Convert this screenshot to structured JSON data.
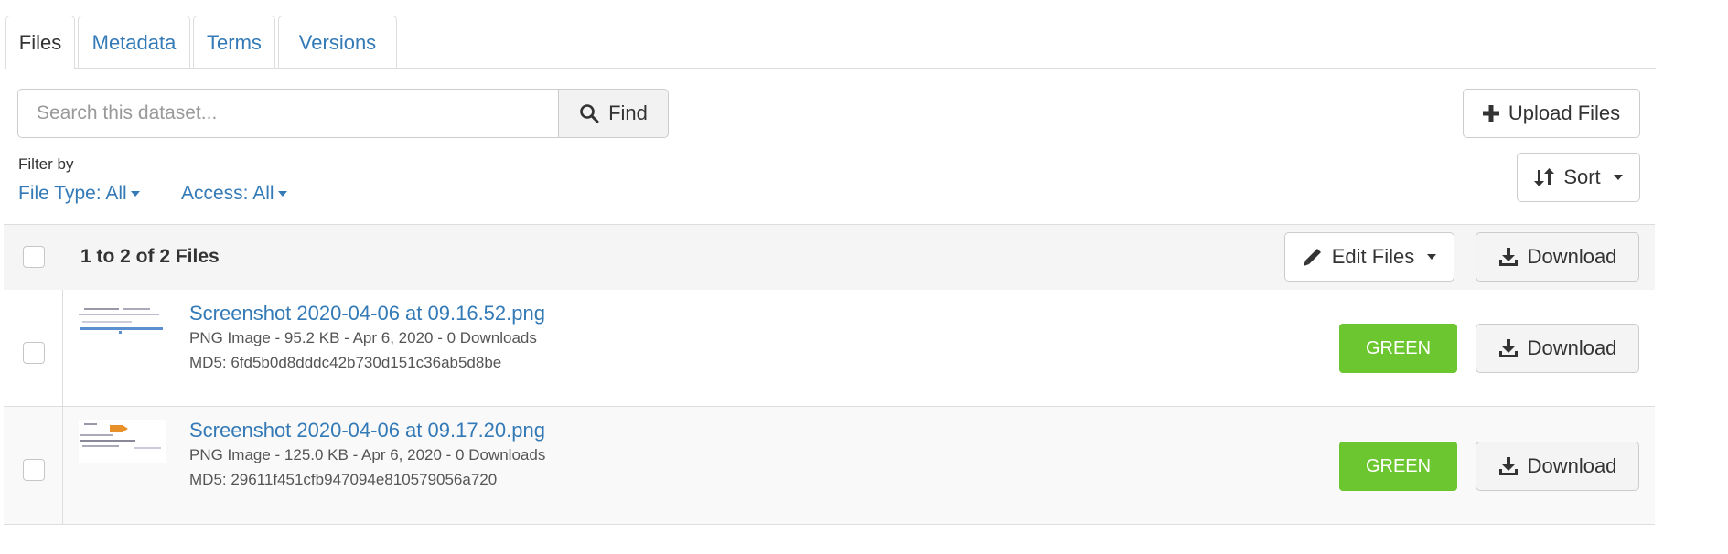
{
  "tabs": [
    {
      "label": "Files"
    },
    {
      "label": "Metadata"
    },
    {
      "label": "Terms"
    },
    {
      "label": "Versions"
    }
  ],
  "search": {
    "placeholder": "Search this dataset...",
    "find_label": "Find"
  },
  "upload": {
    "label": "Upload Files"
  },
  "filters": {
    "label": "Filter by",
    "file_type": "File Type: All",
    "access": "Access: All"
  },
  "sort": {
    "label": "Sort"
  },
  "table": {
    "count_label": "1 to 2 of 2 Files",
    "edit_label": "Edit Files",
    "download_label": "Download"
  },
  "files": [
    {
      "name": "Screenshot 2020-04-06 at 09.16.52.png",
      "info": "PNG Image - 95.2 KB - Apr 6, 2020 - 0 Downloads",
      "md5": "MD5: 6fd5b0d8dddc42b730d151c36ab5d8be",
      "badge": "GREEN",
      "download_label": "Download"
    },
    {
      "name": "Screenshot 2020-04-06 at 09.17.20.png",
      "info": "PNG Image - 125.0 KB - Apr 6, 2020 - 0 Downloads",
      "md5": "MD5: 29611f451cfb947094e810579056a720",
      "badge": "GREEN",
      "download_label": "Download"
    }
  ],
  "colors": {
    "link": "#337ab7",
    "badge_green": "#6cc62f",
    "header_bg": "#f5f5f5",
    "border": "#dddddd"
  }
}
